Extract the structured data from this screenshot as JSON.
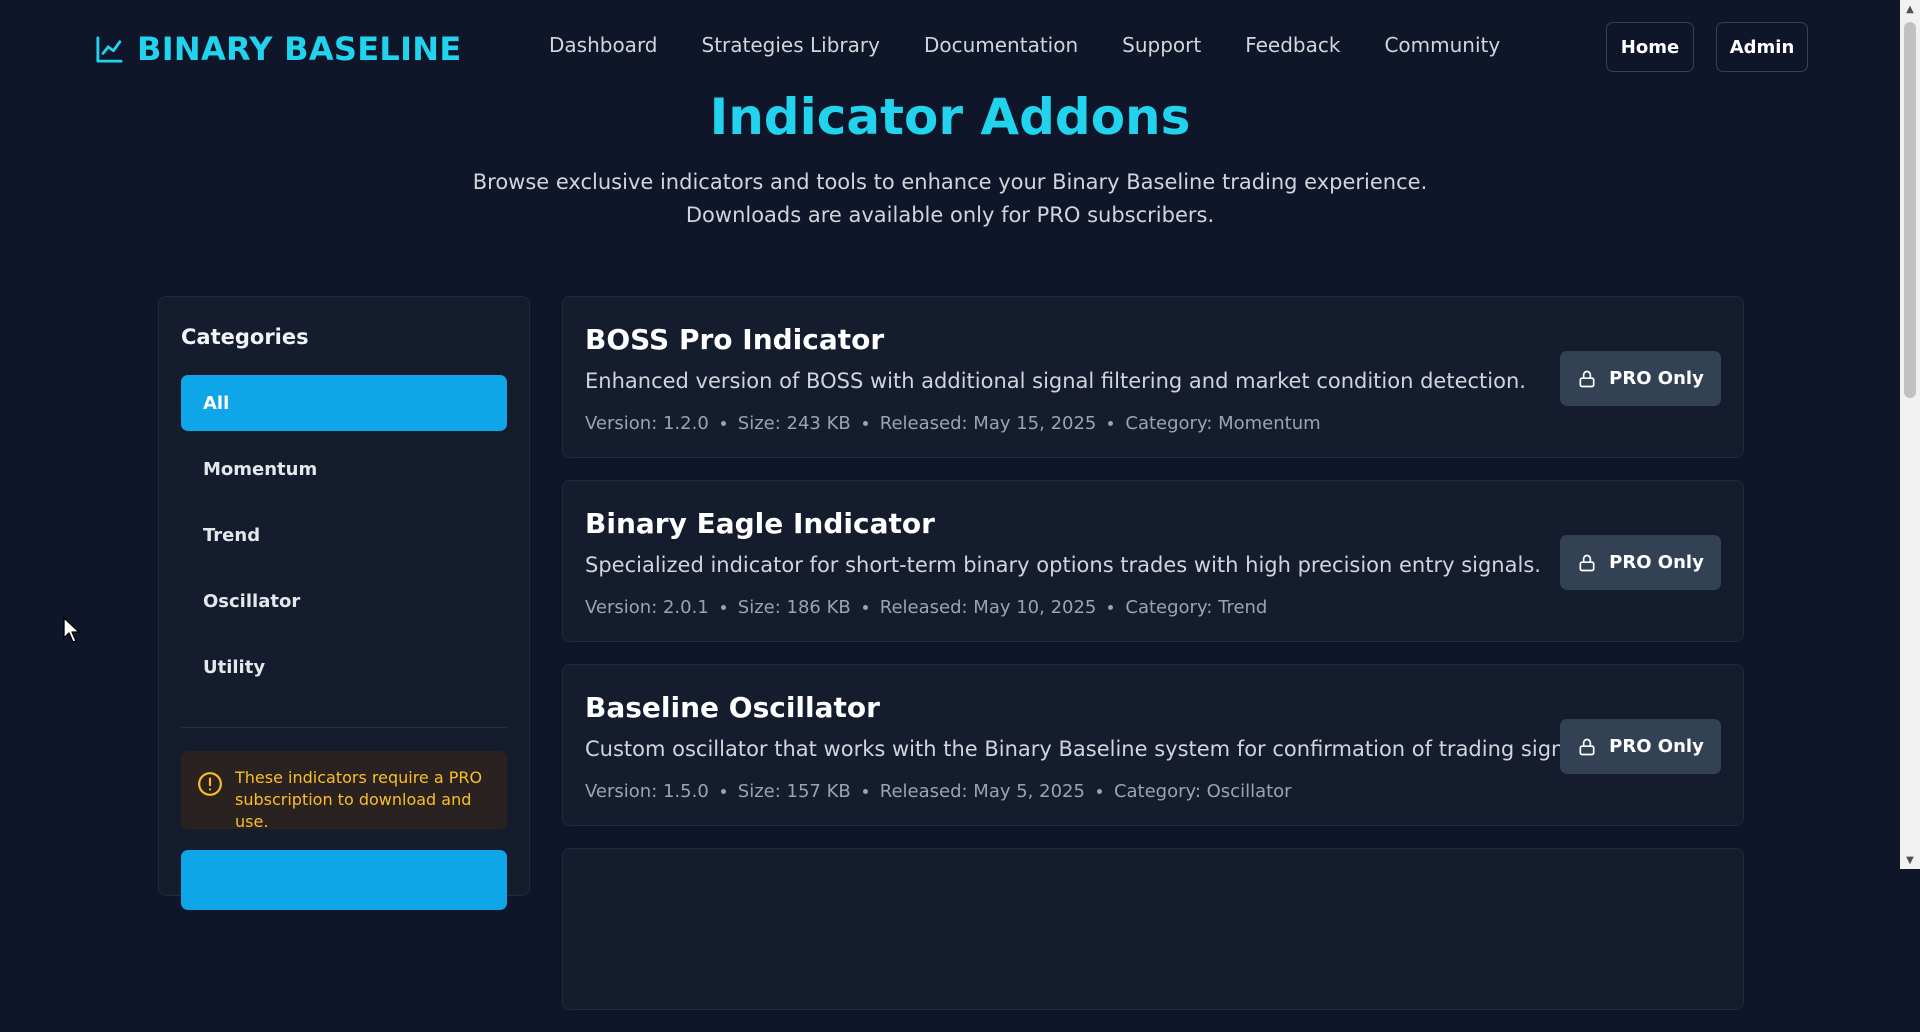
{
  "brand": {
    "name": "BINARY BASELINE",
    "icon": "line-chart-icon"
  },
  "nav": {
    "links": [
      "Dashboard",
      "Strategies Library",
      "Documentation",
      "Support",
      "Feedback",
      "Community"
    ],
    "home_label": "Home",
    "admin_label": "Admin"
  },
  "hero": {
    "title": "Indicator Addons",
    "subtitle": "Browse exclusive indicators and tools to enhance your Binary Baseline trading experience. Downloads are available only for PRO subscribers."
  },
  "sidebar": {
    "title": "Categories",
    "categories": [
      "All",
      "Momentum",
      "Trend",
      "Oscillator",
      "Utility"
    ],
    "active_category": "All",
    "notice": "These indicators require a PRO subscription to download and use."
  },
  "indicators": [
    {
      "name": "BOSS Pro Indicator",
      "description": "Enhanced version of BOSS with additional signal filtering and market condition detection.",
      "version": "Version: 1.2.0",
      "size": "Size: 243 KB",
      "released": "Released: May 15, 2025",
      "category": "Category: Momentum",
      "button": "PRO Only"
    },
    {
      "name": "Binary Eagle Indicator",
      "description": "Specialized indicator for short-term binary options trades with high precision entry signals.",
      "version": "Version: 2.0.1",
      "size": "Size: 186 KB",
      "released": "Released: May 10, 2025",
      "category": "Category: Trend",
      "button": "PRO Only"
    },
    {
      "name": "Baseline Oscillator",
      "description": "Custom oscillator that works with the Binary Baseline system for confirmation of trading signals.",
      "version": "Version: 1.5.0",
      "size": "Size: 157 KB",
      "released": "Released: May 5, 2025",
      "category": "Category: Oscillator",
      "button": "PRO Only"
    }
  ],
  "colors": {
    "background": "#0f1629",
    "accent": "#22d3ee",
    "active": "#0ea5e9",
    "card": "#141c2e",
    "warning": "#fbbf24"
  }
}
